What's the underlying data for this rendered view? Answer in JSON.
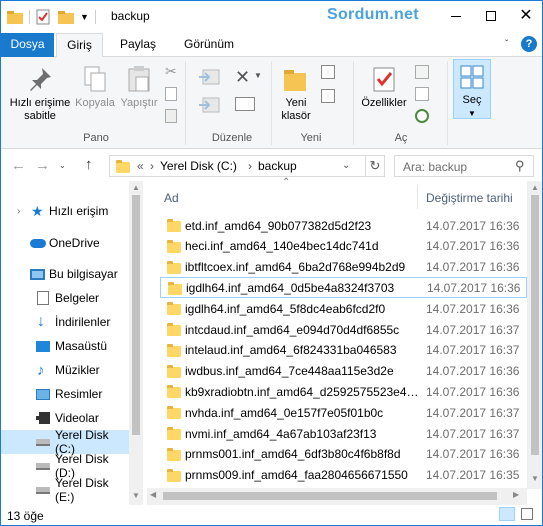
{
  "window": {
    "title": "backup",
    "watermark": "Sordum.net"
  },
  "ribbon": {
    "tabs": [
      "Dosya",
      "Giriş",
      "Paylaş",
      "Görünüm"
    ],
    "groups": {
      "pano": {
        "label": "Pano",
        "pin": "Hızlı erişime sabitle",
        "copy": "Kopyala",
        "paste": "Yapıştır"
      },
      "duzenle": {
        "label": "Düzenle"
      },
      "yeni": {
        "label": "Yeni",
        "new_folder": "Yeni klasör"
      },
      "ac": {
        "label": "Aç",
        "properties": "Özellikler"
      },
      "sec": {
        "label": "Seç"
      }
    }
  },
  "address": {
    "prefix": "«",
    "segments": [
      "Yerel Disk (C:)",
      "backup"
    ],
    "search_placeholder": "Ara: backup"
  },
  "sidebar": {
    "items": [
      {
        "label": "Hızlı erişim",
        "icon": "star-icon"
      },
      {
        "label": "OneDrive",
        "icon": "cloud-icon"
      },
      {
        "label": "Bu bilgisayar",
        "icon": "computer-icon"
      },
      {
        "label": "Belgeler",
        "icon": "documents-icon"
      },
      {
        "label": "İndirilenler",
        "icon": "download-icon"
      },
      {
        "label": "Masaüstü",
        "icon": "desktop-icon"
      },
      {
        "label": "Müzikler",
        "icon": "music-icon"
      },
      {
        "label": "Resimler",
        "icon": "pictures-icon"
      },
      {
        "label": "Videolar",
        "icon": "videos-icon"
      },
      {
        "label": "Yerel Disk (C:)",
        "icon": "windows-drive-icon"
      },
      {
        "label": "Yerel Disk (D:)",
        "icon": "drive-icon"
      },
      {
        "label": "Yerel Disk (E:)",
        "icon": "drive-icon"
      }
    ]
  },
  "filelist": {
    "columns": {
      "name": "Ad",
      "modified": "Değiştirme tarihi"
    },
    "rows": [
      {
        "name": "etd.inf_amd64_90b077382d5d2f23",
        "date": "14.07.2017 16:36"
      },
      {
        "name": "heci.inf_amd64_140e4bec14dc741d",
        "date": "14.07.2017 16:36"
      },
      {
        "name": "ibtfltcoex.inf_amd64_6ba2d768e994b2d9",
        "date": "14.07.2017 16:36"
      },
      {
        "name": "igdlh64.inf_amd64_0d5be4a8324f3703",
        "date": "14.07.2017 16:36"
      },
      {
        "name": "igdlh64.inf_amd64_5f8dc4eab6fcd2f0",
        "date": "14.07.2017 16:36"
      },
      {
        "name": "intcdaud.inf_amd64_e094d70d4df6855c",
        "date": "14.07.2017 16:37"
      },
      {
        "name": "intelaud.inf_amd64_6f824331ba046583",
        "date": "14.07.2017 16:37"
      },
      {
        "name": "iwdbus.inf_amd64_7ce448aa115e3d2e",
        "date": "14.07.2017 16:36"
      },
      {
        "name": "kb9xradiobtn.inf_amd64_d2592575523e4…",
        "date": "14.07.2017 16:36"
      },
      {
        "name": "nvhda.inf_amd64_0e157f7e05f01b0c",
        "date": "14.07.2017 16:37"
      },
      {
        "name": "nvmi.inf_amd64_4a67ab103af23f13",
        "date": "14.07.2017 16:37"
      },
      {
        "name": "prnms001.inf_amd64_6df3b80c4f6b8f8d",
        "date": "14.07.2017 16:36"
      },
      {
        "name": "prnms009.inf_amd64_faa2804656671550",
        "date": "14.07.2017 16:35"
      }
    ]
  },
  "status": {
    "count": "13 öğe"
  }
}
